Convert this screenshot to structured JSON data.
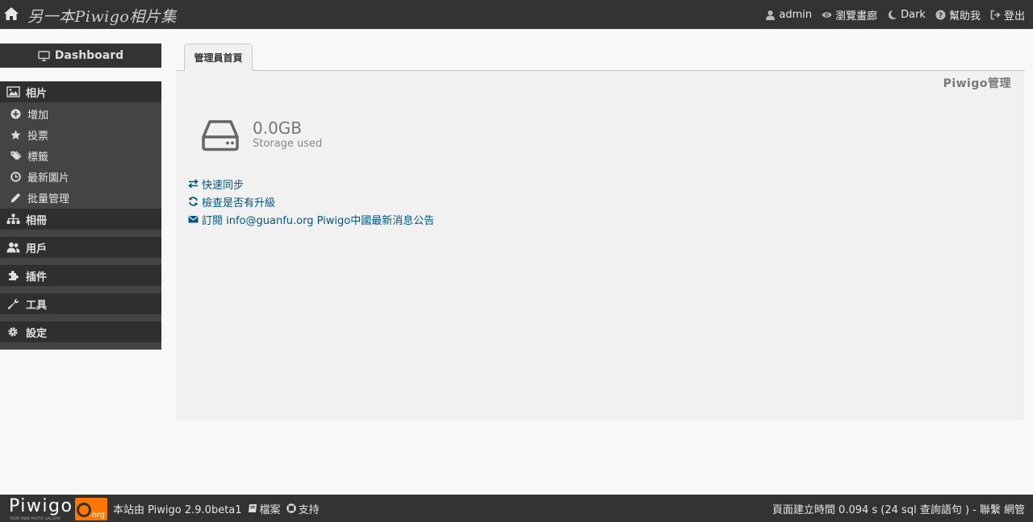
{
  "header": {
    "gallery_title": "另一本Piwigo相片集",
    "menu": [
      {
        "label": "admin",
        "icon": "user-icon"
      },
      {
        "label": "瀏覽畫廊",
        "icon": "eye-icon"
      },
      {
        "label": "Dark",
        "icon": "moon-icon"
      },
      {
        "label": "幫助我",
        "icon": "question-circle-icon"
      },
      {
        "label": "登出",
        "icon": "sign-out-icon"
      }
    ]
  },
  "sidebar": {
    "dashboard_label": "Dashboard",
    "sections": [
      {
        "label": "相片",
        "icon": "image-icon",
        "items": [
          {
            "label": "增加",
            "icon": "plus-circle-icon"
          },
          {
            "label": "投票",
            "icon": "star-icon"
          },
          {
            "label": "標籤",
            "icon": "tags-icon"
          },
          {
            "label": "最新圖片",
            "icon": "clock-icon"
          },
          {
            "label": "批量管理",
            "icon": "pencil-icon"
          }
        ]
      },
      {
        "label": "相冊",
        "icon": "sitemap-icon"
      },
      {
        "label": "用戶",
        "icon": "users-icon"
      },
      {
        "label": "插件",
        "icon": "puzzle-icon"
      },
      {
        "label": "工具",
        "icon": "wrench-icon"
      },
      {
        "label": "設定",
        "icon": "gear-icon"
      }
    ]
  },
  "main": {
    "tab_label": "管理員首頁",
    "page_heading": "Piwigo管理",
    "storage": {
      "value": "0.0GB",
      "label": "Storage used",
      "icon": "hdd-icon"
    },
    "links": [
      {
        "label": "快速同步",
        "icon": "exchange-icon"
      },
      {
        "label": "檢查是否有升級",
        "icon": "refresh-icon"
      },
      {
        "label": "訂閱 info@guanfu.org Piwigo中國最新消息公告",
        "icon": "envelope-icon"
      }
    ]
  },
  "footer": {
    "logo_text": "Piwigo",
    "logo_suffix": "org",
    "logo_tagline": "YOUR OWN PHOTO GALLERY",
    "powered_by": "本站由 Piwigo 2.9.0beta1",
    "docs_label": "檔案",
    "support_label": "支持",
    "page_time": "頁面建立時間 0.094 s (24 sql 查詢語句 ) -",
    "contact_label": "聯繫 網管"
  },
  "colors": {
    "topbar": "#333333",
    "sidebar_header": "#2f2f2f",
    "sidebar_sub": "#444444",
    "content_bg": "#f1f1f1",
    "link": "#005580",
    "logo_orange": "#ff7700"
  }
}
